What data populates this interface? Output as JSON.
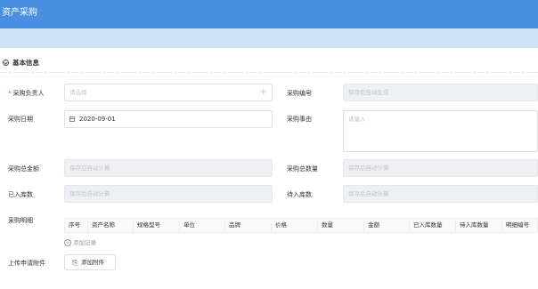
{
  "header": {
    "title": "资产采购"
  },
  "section": {
    "title": "基本信息"
  },
  "form": {
    "purchaser_label": "采购负责人",
    "purchaser_placeholder": "请选择",
    "purchase_no_label": "采购编号",
    "purchase_no_placeholder": "保存后自动生成",
    "purchase_date_label": "采购日期",
    "purchase_date_value": "2020-09-01",
    "reason_label": "采购事由",
    "reason_placeholder": "请输入",
    "total_amount_label": "采购总金额",
    "total_amount_placeholder": "保存后自动计算",
    "total_qty_label": "采购总数量",
    "total_qty_placeholder": "保存后自动计算",
    "stored_label": "已入库数",
    "stored_placeholder": "保存后自动计算",
    "pending_label": "待入库数",
    "pending_placeholder": "保存后自动计算",
    "details_label": "采购明细",
    "attachment_label": "上传申请附件"
  },
  "table": {
    "columns": [
      "序号",
      "资产名称",
      "规格型号",
      "单位",
      "品牌",
      "价格",
      "数量",
      "金额",
      "已入库数量",
      "待入库数量",
      "明细编号"
    ]
  },
  "actions": {
    "add_record": "添加记录",
    "add_attachment": "添加附件"
  },
  "icons": {
    "collapse": "chevron-circle-icon",
    "plus": "plus-icon",
    "calendar": "calendar-icon",
    "clip": "paperclip-icon"
  },
  "colors": {
    "header": "#4a90e2",
    "subbar": "#cfe3f8",
    "required": "#e74c3c"
  }
}
